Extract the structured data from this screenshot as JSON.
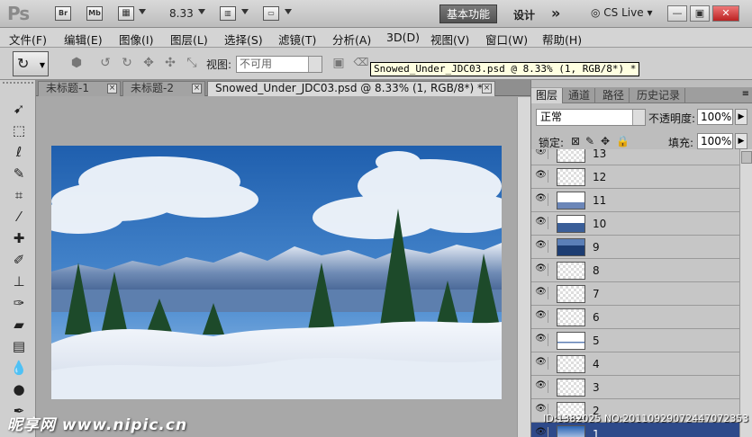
{
  "appbar": {
    "logo": "Ps",
    "bridge": "Br",
    "minibridge": "Mb",
    "zoom": "8.33",
    "workspace_active": "基本功能",
    "workspace_design": "设计",
    "more": "»",
    "cslive": "CS Live"
  },
  "menu": [
    "文件(F)",
    "编辑(E)",
    "图像(I)",
    "图层(L)",
    "选择(S)",
    "滤镜(T)",
    "分析(A)",
    "3D(D)",
    "视图(V)",
    "窗口(W)",
    "帮助(H)"
  ],
  "options": {
    "view_label": "视图:",
    "view_value": "不可用",
    "tooltip": "Snowed_Under_JDC03.psd @ 8.33% (1, RGB/8*) *"
  },
  "tabs": [
    {
      "label": "未标题-1"
    },
    {
      "label": "未标题-2"
    },
    {
      "label": "Snowed_Under_JDC03.psd @ 8.33% (1, RGB/8*) *"
    }
  ],
  "panel": {
    "tabs": [
      "图层",
      "通道",
      "路径",
      "历史记录"
    ],
    "blend_mode": "正常",
    "opacity_label": "不透明度:",
    "opacity": "100%",
    "lock_label": "锁定:",
    "fill_label": "填充:",
    "fill": "100%",
    "layers": [
      "13",
      "12",
      "11",
      "10",
      "9",
      "8",
      "7",
      "6",
      "5",
      "4",
      "3",
      "2",
      "1"
    ],
    "selected_layer": "1"
  },
  "watermark": {
    "site": "昵享网 www.nipic.cn",
    "id": "ID:1382025 NO:20110929072447072353"
  }
}
